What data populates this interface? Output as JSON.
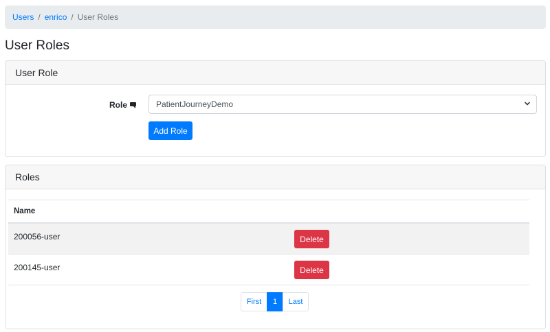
{
  "breadcrumb": {
    "items": [
      "Users",
      "enrico"
    ],
    "separator": "/",
    "current": "User Roles"
  },
  "page": {
    "title": "User Roles"
  },
  "user_role_card": {
    "header": "User Role",
    "role_label": "Role",
    "role_icon": "comment-icon",
    "select_value": "PatientJourneyDemo",
    "add_button": "Add Role"
  },
  "roles_card": {
    "header": "Roles",
    "columns": [
      "Name"
    ],
    "rows": [
      {
        "name": "200056-user",
        "action": "Delete"
      },
      {
        "name": "200145-user",
        "action": "Delete"
      }
    ],
    "pagination": {
      "first": "First",
      "current": "1",
      "last": "Last"
    }
  },
  "colors": {
    "primary": "#007bff",
    "danger": "#dc3545",
    "breadcrumb_bg": "#e9ecef",
    "card_header_bg": "#f7f7f7",
    "stripe_bg": "#f2f2f2"
  }
}
